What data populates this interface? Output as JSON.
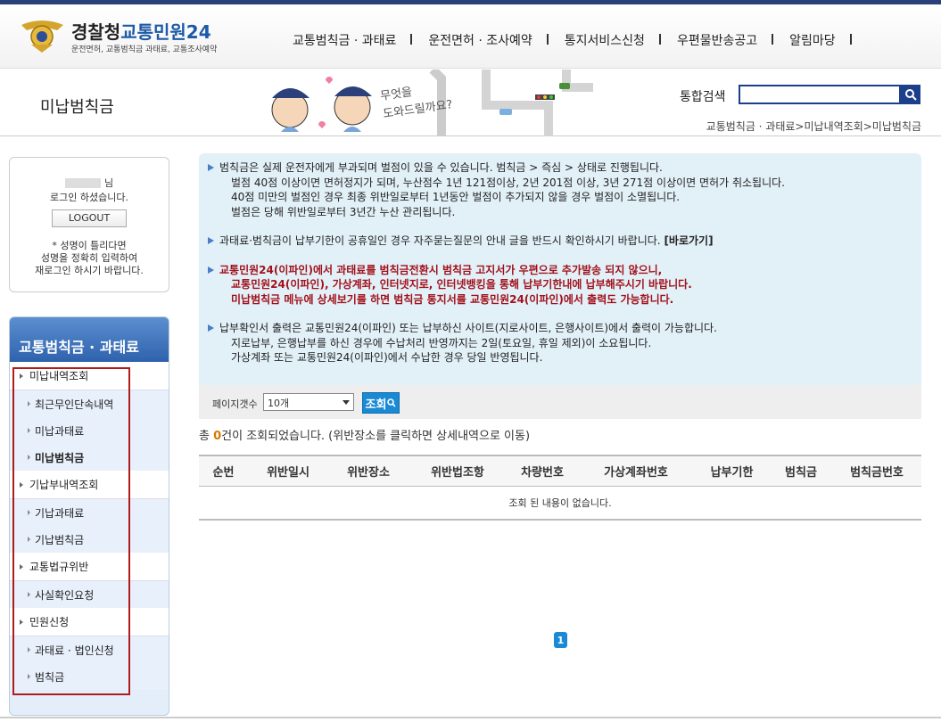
{
  "header": {
    "logo_main": "경찰청",
    "logo_blue": "교통민원24",
    "logo_sub": "운전면허, 교통범칙금 과태료, 교통조사예약",
    "gnb": [
      "교통범칙금 · 과태료",
      "운전면허 · 조사예약",
      "통지서비스신청",
      "우편물반송공고",
      "알림마당"
    ]
  },
  "subhead": {
    "page_title": "미납범칙금",
    "search_label": "통합검색",
    "search_value": "",
    "illust_text": "무엇을 도와드릴까요?",
    "breadcrumb": "교통범칙금 · 과태료>미납내역조회>미납범칙금"
  },
  "login": {
    "name_suffix": "님",
    "logged_in": "로그인 하셨습니다.",
    "logout": "LOGOUT",
    "note_lines": [
      "* 성명이 틀리다면",
      "성명을 정확히 입력하여",
      "재로그인 하시기 바랍니다."
    ]
  },
  "lnb": {
    "title": "교통범칙금 · 과태료",
    "items": [
      {
        "label": "미납내역조회",
        "level": 1
      },
      {
        "label": "최근무인단속내역",
        "level": 2
      },
      {
        "label": "미납과태료",
        "level": 2
      },
      {
        "label": "미납범칙금",
        "level": 2,
        "active": true
      },
      {
        "label": "기납부내역조회",
        "level": 1
      },
      {
        "label": "기납과태료",
        "level": 2
      },
      {
        "label": "기납범칙금",
        "level": 2
      },
      {
        "label": "교통법규위반",
        "level": 1
      },
      {
        "label": "사실확인요청",
        "level": 2
      },
      {
        "label": "민원신청",
        "level": 1
      },
      {
        "label": "과태료 · 법인신청",
        "level": 2
      },
      {
        "label": "범칙금",
        "level": 2
      }
    ]
  },
  "notice": {
    "p1": [
      "범칙금은 실제 운전자에게 부과되며 벌점이 있을 수 있습니다. 범칙금 > 즉심 > 상태로 진행됩니다.",
      "벌점 40점 이상이면 면허정지가 되며, 누산점수 1년 121점이상, 2년 201점 이상, 3년 271점 이상이면 면허가 취소됩니다.",
      "40점 미만의 벌점인 경우 최종 위반일로부터 1년동안 벌점이 추가되지 않을 경우 벌점이 소멸됩니다.",
      "벌점은 당해 위반일로부터 3년간 누산 관리됩니다."
    ],
    "p2": "과태료·범칙금이 납부기한이 공휴일인 경우 자주묻는질문의 안내 글을 반드시 확인하시기 바랍니다.",
    "p2_link": "[바로가기]",
    "p3": [
      "교통민원24(이파인)에서 과태료를 범칙금전환시 범칙금 고지서가 우편으로 추가발송 되지 않으니,",
      "교통민원24(이파인), 가상계좌, 인터넷지로, 인터넷뱅킹을 통해 납부기한내에 납부해주시기 바랍니다.",
      "미납범칙금 메뉴에 상세보기를 하면 범칙금 통지서를 교통민원24(이파인)에서 출력도 가능합니다."
    ],
    "p4": [
      "납부확인서 출력은 교통민원24(이파인) 또는 납부하신 사이트(지로사이트, 은행사이트)에서 출력이 가능합니다.",
      "지로납부, 은행납부를 하신 경우에 수납처리 반영까지는 2일(토요일, 휴일 제외)이 소요됩니다.",
      "가상계좌 또는 교통민원24(이파인)에서 수납한 경우 당일 반영됩니다."
    ]
  },
  "filter": {
    "label": "페이지갯수",
    "selected": "10개",
    "button": "조회"
  },
  "result": {
    "prefix": "총 ",
    "count": "0",
    "suffix": "건이 조회되었습니다. (위반장소를 클릭하면 상세내역으로 이동)"
  },
  "table": {
    "headers": [
      "순번",
      "위반일시",
      "위반장소",
      "위반법조항",
      "차량번호",
      "가상계좌번호",
      "납부기한",
      "범칙금",
      "범칙금번호"
    ],
    "empty": "조회 된 내용이 없습니다."
  },
  "pagination": {
    "current": "1"
  },
  "colors": {
    "brand_blue": "#1c5aa7",
    "accent_blue": "#1a8ad4",
    "notice_red": "#a2111a",
    "highlight_red": "#b01c1c"
  }
}
